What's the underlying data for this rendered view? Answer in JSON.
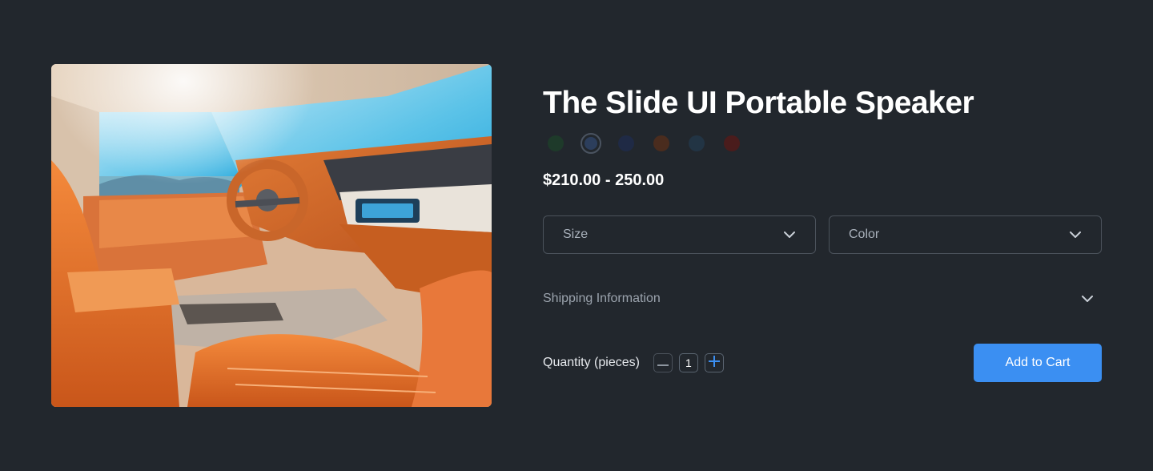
{
  "product": {
    "image_alt": "Car interior with orange leather seats",
    "title": "The Slide UI Portable Speaker",
    "price_range": "$210.00 - 250.00"
  },
  "swatches": [
    {
      "color": "#1e3a2a",
      "selected": false
    },
    {
      "color": "#2c3e5c",
      "selected": true
    },
    {
      "color": "#1f2a45",
      "selected": false
    },
    {
      "color": "#4a2c1e",
      "selected": false
    },
    {
      "color": "#223444",
      "selected": false
    },
    {
      "color": "#4a1c1c",
      "selected": false
    }
  ],
  "selects": {
    "size_label": "Size",
    "color_label": "Color"
  },
  "shipping": {
    "label": "Shipping Information"
  },
  "quantity": {
    "label": "Quantity (pieces)",
    "value": "1"
  },
  "cart": {
    "button_label": "Add to Cart"
  },
  "colors": {
    "background": "#22272d",
    "accent": "#3b8ff2",
    "border": "#4b525b"
  },
  "icons": {
    "select_chevron": "chevron-down-icon",
    "minus": "minus-icon",
    "plus": "plus-icon"
  }
}
